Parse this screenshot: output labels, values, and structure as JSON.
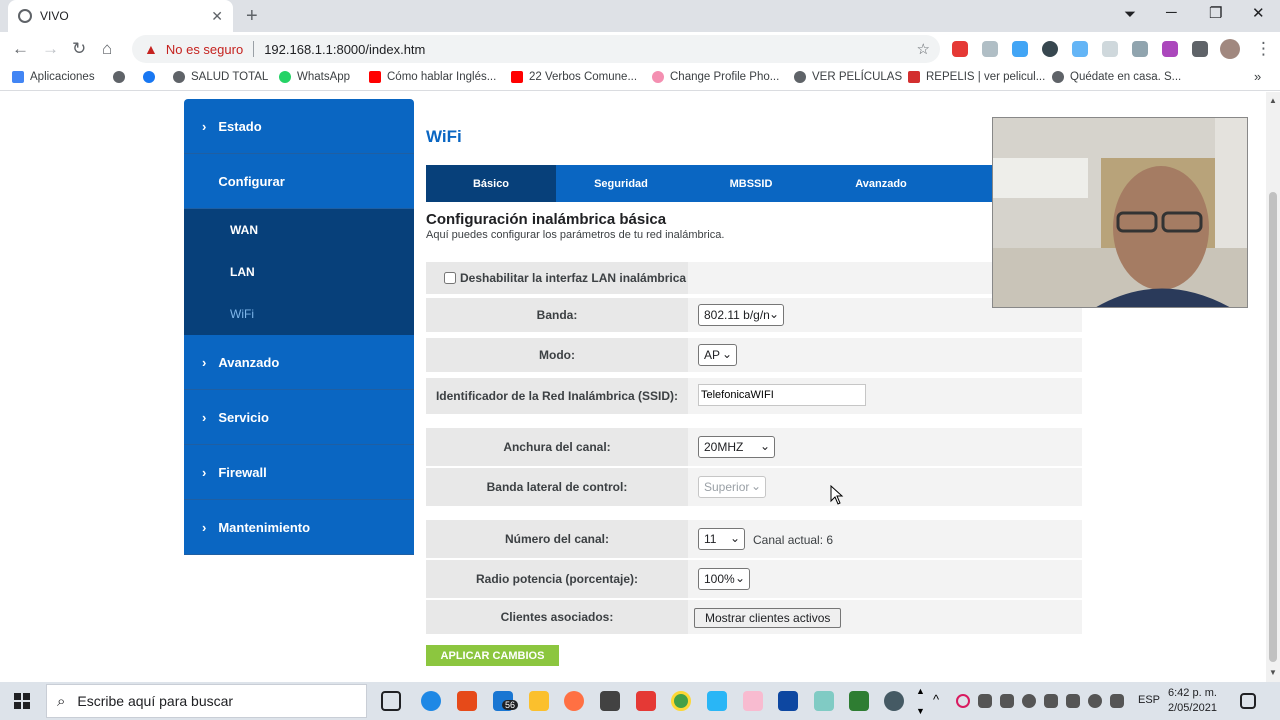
{
  "browser": {
    "tab_title": "VIVO",
    "security_label": "No es seguro",
    "url": "192.168.1.1:8000/index.htm"
  },
  "bookmarks": [
    {
      "label": "Aplicaciones"
    },
    {
      "label": ""
    },
    {
      "label": ""
    },
    {
      "label": "SALUD TOTAL"
    },
    {
      "label": "WhatsApp"
    },
    {
      "label": "Cómo hablar Inglés..."
    },
    {
      "label": "22 Verbos Comune..."
    },
    {
      "label": "Change Profile Pho..."
    },
    {
      "label": "VER PELÍCULAS"
    },
    {
      "label": "REPELIS | ver pelicul..."
    },
    {
      "label": "Quédate en casa. S..."
    }
  ],
  "sidebar": {
    "items": [
      {
        "label": "Estado"
      },
      {
        "label": "Configurar"
      },
      {
        "label": "Avanzado"
      },
      {
        "label": "Servicio"
      },
      {
        "label": "Firewall"
      },
      {
        "label": "Mantenimiento"
      }
    ],
    "subitems": [
      {
        "label": "WAN"
      },
      {
        "label": "LAN"
      },
      {
        "label": "WiFi"
      }
    ]
  },
  "main": {
    "title": "WiFi",
    "tabs": [
      "Básico",
      "Seguridad",
      "MBSSID",
      "Avanzado"
    ],
    "section_title": "Configuración inalámbrica básica",
    "section_desc": "Aquí puedes configurar los parámetros de tu red inalámbrica.",
    "disable_label": "Deshabilitar la interfaz LAN inalámbrica",
    "fields": {
      "banda_label": "Banda:",
      "banda_value": "802.11 b/g/n",
      "modo_label": "Modo:",
      "modo_value": "AP",
      "ssid_label": "Identificador de la Red Inalámbrica (SSID):",
      "ssid_value": "TelefonicaWIFI",
      "anchura_label": "Anchura del canal:",
      "anchura_value": "20MHZ",
      "banda_lateral_label": "Banda lateral de control:",
      "banda_lateral_value": "Superior",
      "canal_label": "Número del canal:",
      "canal_value": "11",
      "canal_actual": "Canal actual: 6",
      "potencia_label": "Radio potencia (porcentaje):",
      "potencia_value": "100%",
      "clientes_label": "Clientes asociados:",
      "clientes_button": "Mostrar clientes activos"
    },
    "apply_button": "APLICAR CAMBIOS"
  },
  "taskbar": {
    "search_placeholder": "Escribe aquí para buscar",
    "mail_badge": "56",
    "lang": "ESP",
    "time": "6:42 p. m.",
    "date": "2/05/2021"
  }
}
